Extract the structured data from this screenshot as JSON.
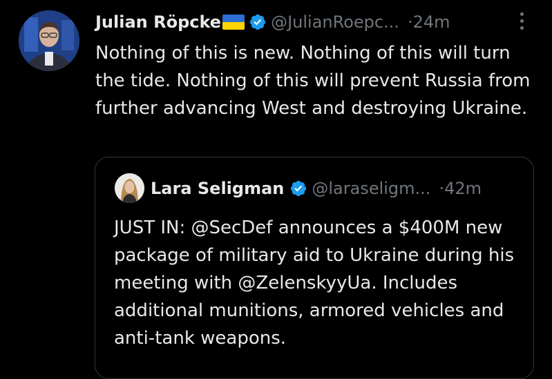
{
  "tweet": {
    "author_name": "Julian Röpcke",
    "flag_icon": "ukraine-flag-icon",
    "handle": "@JulianRoepc...",
    "separator": "·",
    "time": "24m",
    "text": "Nothing of this is new. Nothing of this will turn the tide. Nothing of this will prevent Russia from further advancing West and destroying Ukraine."
  },
  "quoted": {
    "author_name": "Lara Seligman",
    "handle": "@laraseligm...",
    "separator": "·",
    "time": "42m",
    "text": "JUST IN: @SecDef announces a $400M new package of military aid to Ukraine during his meeting with @ZelenskyyUa. Includes additional munitions, armored vehicles and anti-tank weapons."
  },
  "colors": {
    "background": "#000000",
    "text": "#e7e9ea",
    "secondary_text": "#71767b",
    "verified_badge": "#1d9bf0",
    "border": "#333639",
    "flag_blue": "#2f6ed3",
    "flag_yellow": "#ffd500"
  }
}
